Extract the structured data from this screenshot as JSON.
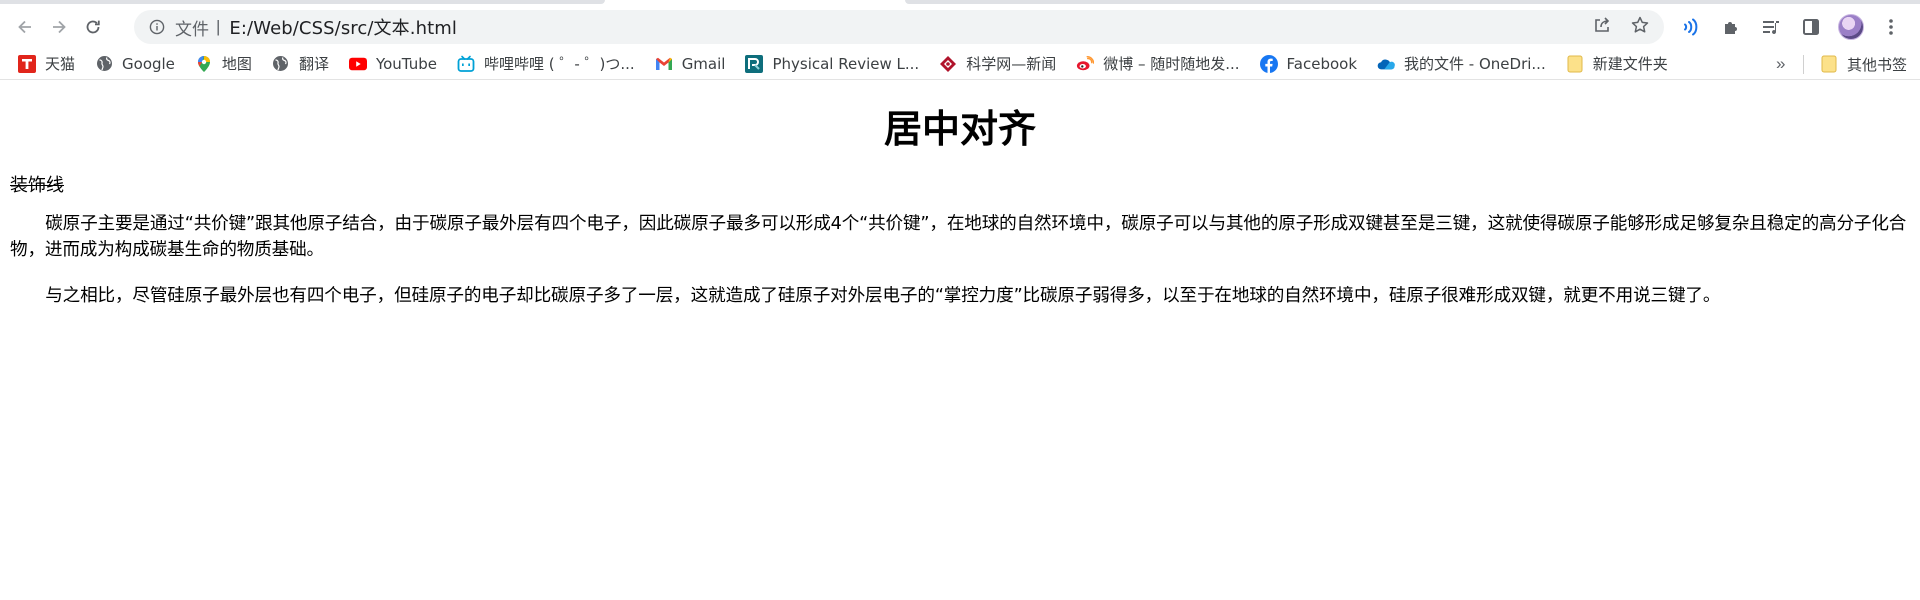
{
  "browser": {
    "address_bar": {
      "scheme_label": "文件",
      "separator": "|",
      "url": "E:/Web/CSS/src/文本.html"
    },
    "icons": {
      "back": "back-arrow-icon",
      "forward": "forward-arrow-icon",
      "reload": "reload-icon",
      "info": "info-icon",
      "share": "share-icon",
      "star": "star-icon",
      "read_aloud": "read-aloud-icon",
      "extensions": "puzzle-icon",
      "reading_list": "reading-list-icon",
      "side_panel": "side-panel-icon",
      "menu": "kebab-menu-icon"
    },
    "bookmarks": [
      {
        "label": "天猫",
        "icon": "tmall-icon"
      },
      {
        "label": "Google",
        "icon": "globe-icon"
      },
      {
        "label": "地图",
        "icon": "maps-pin-icon"
      },
      {
        "label": "翻译",
        "icon": "globe-icon"
      },
      {
        "label": "YouTube",
        "icon": "youtube-icon"
      },
      {
        "label": "哔哩哔哩 ( ゜- ゜)つ...",
        "icon": "bilibili-icon"
      },
      {
        "label": "Gmail",
        "icon": "gmail-icon"
      },
      {
        "label": "Physical Review L...",
        "icon": "prl-icon"
      },
      {
        "label": "科学网—新闻",
        "icon": "sciencenet-icon"
      },
      {
        "label": "微博 – 随时随地发...",
        "icon": "weibo-icon"
      },
      {
        "label": "Facebook",
        "icon": "facebook-icon"
      },
      {
        "label": "我的文件 - OneDri...",
        "icon": "onedrive-icon"
      },
      {
        "label": "新建文件夹",
        "icon": "folder-icon"
      }
    ],
    "bookmarks_overflow": "»",
    "other_bookmarks": {
      "label": "其他书签",
      "icon": "folder-icon"
    },
    "colors": {
      "toolbar_bg": "#ffffff",
      "omnibox_bg": "#f1f3f4",
      "accent_blue": "#1a73e8"
    }
  },
  "page": {
    "heading": "居中对齐",
    "decoration_text": "装饰线",
    "paragraphs": [
      "碳原子主要是通过“共价键”跟其他原子结合，由于碳原子最外层有四个电子，因此碳原子最多可以形成4个“共价键”，在地球的自然环境中，碳原子可以与其他的原子形成双键甚至是三键，这就使得碳原子能够形成足够复杂且稳定的高分子化合物，进而成为构成碳基生命的物质基础。",
      "与之相比，尽管硅原子最外层也有四个电子，但硅原子的电子却比碳原子多了一层，这就造成了硅原子对外层电子的“掌控力度”比碳原子弱得多，以至于在地球的自然环境中，硅原子很难形成双键，就更不用说三键了。"
    ]
  }
}
